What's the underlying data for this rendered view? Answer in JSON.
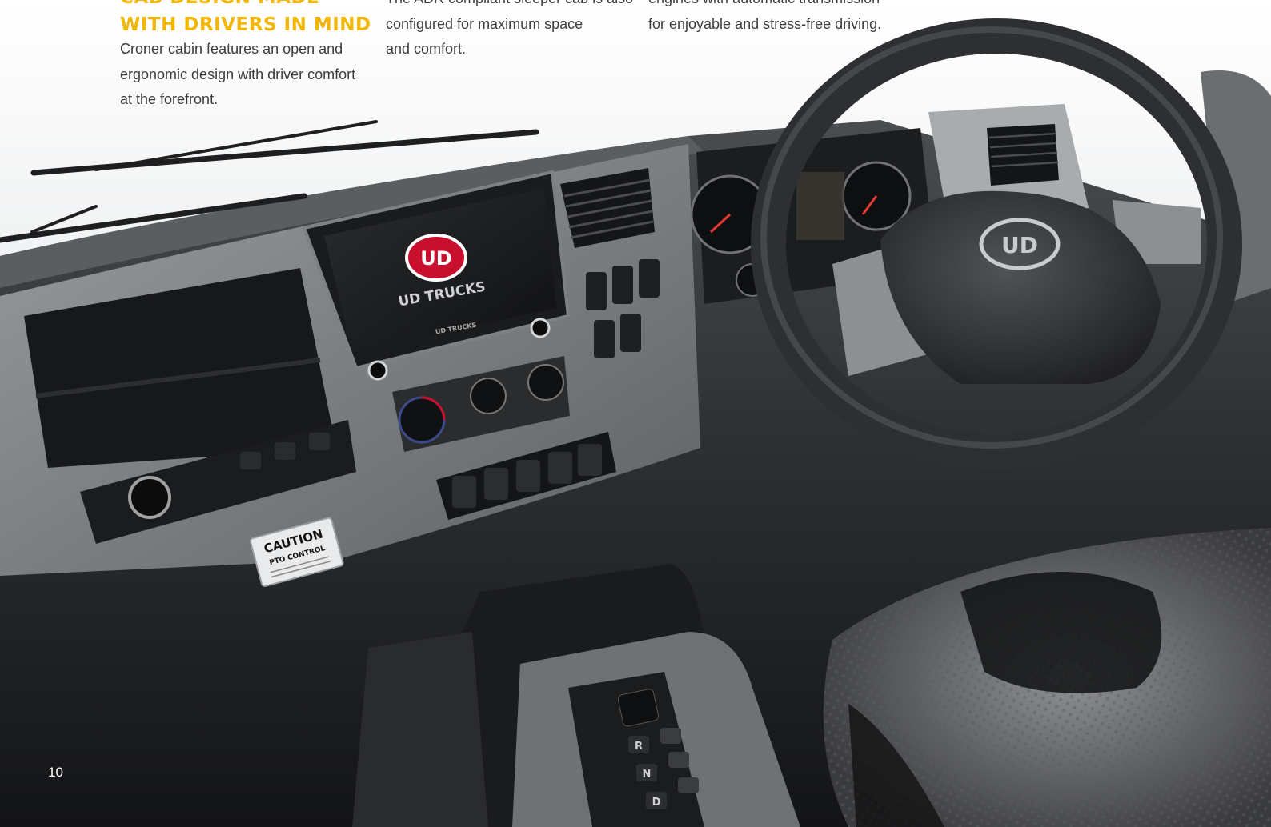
{
  "section": {
    "heading_lines": [
      "CAB DESIGN MADE",
      "WITH DRIVERS IN MIND"
    ],
    "accent_color": "#f2b705"
  },
  "columns": [
    {
      "lines": [
        "Croner cabin features an open and",
        "ergonomic design with driver comfort",
        "at the forefront."
      ]
    },
    {
      "lines": [
        "The ADR compliant sleeper cab is also",
        "configured for maximum space",
        "and comfort."
      ]
    },
    {
      "lines": [
        "engines with automatic transmission",
        "for enjoyable and stress-free driving."
      ]
    }
  ],
  "photo": {
    "screen_logo": "UD",
    "screen_brand": "UD TRUCKS",
    "screen_footer": "UD TRUCKS",
    "wheel_logo": "UD",
    "caution_title": "CAUTION",
    "caution_sub": "PTO CONTROL",
    "gear_labels": [
      "R",
      "N",
      "D"
    ]
  },
  "page_number": "10"
}
